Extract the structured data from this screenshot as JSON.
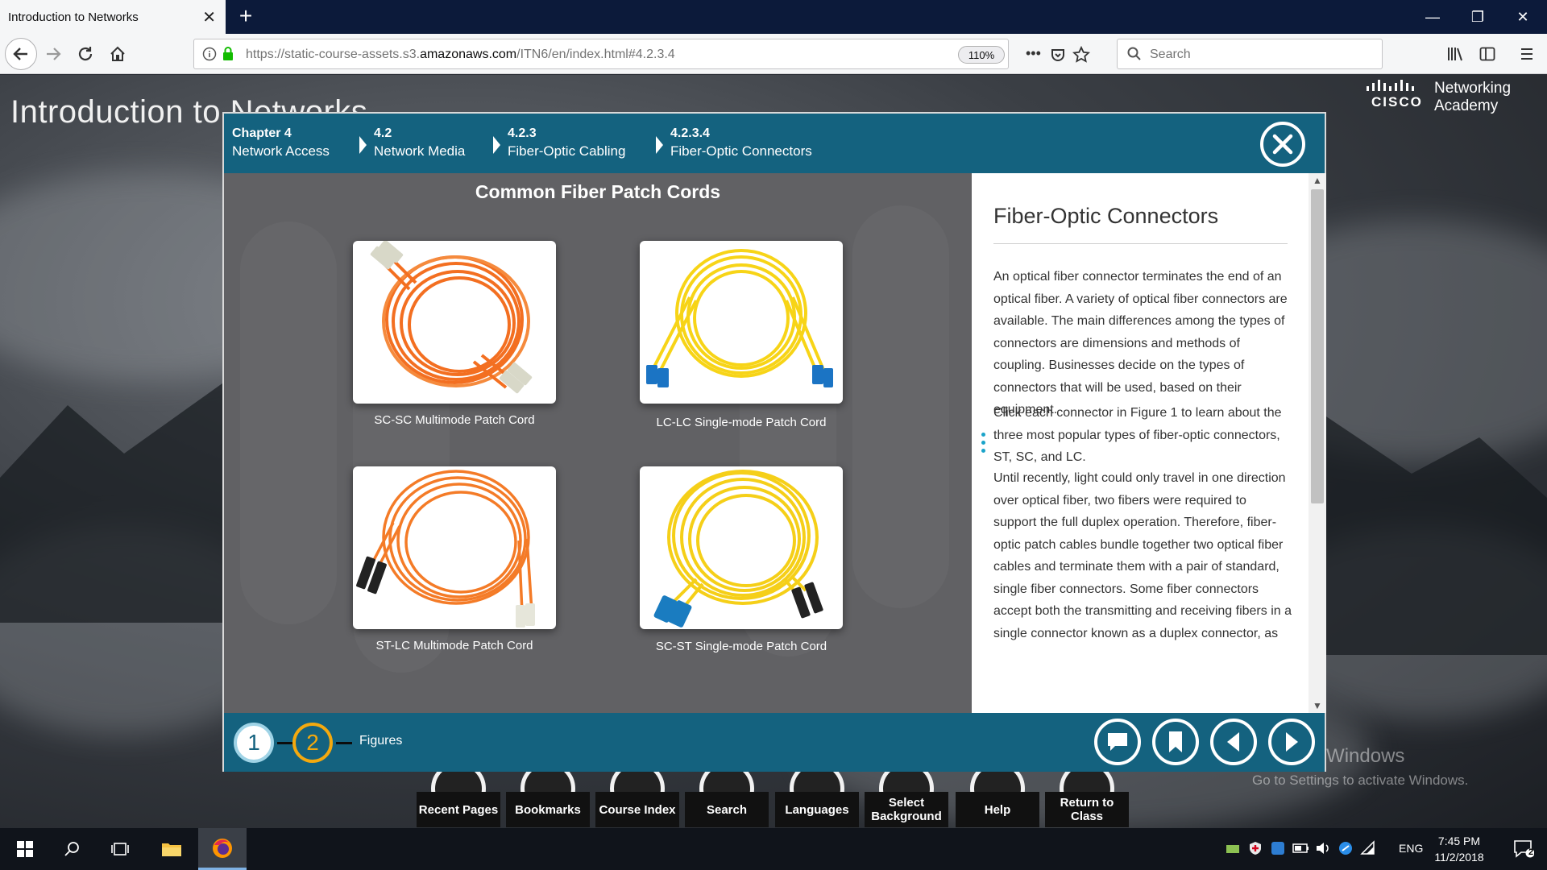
{
  "browser": {
    "tab_title": "Introduction to Networks",
    "url_host_prefix": "https://static-course-assets.s3.",
    "url_host_domain": "amazonaws.com",
    "url_path": "/ITN6/en/index.html#4.2.3.4",
    "zoom": "110%",
    "search_placeholder": "Search"
  },
  "page": {
    "course_title": "Introduction to Networks",
    "logo_brand": "CISCO",
    "logo_line1": "Networking",
    "logo_line2": "Academy"
  },
  "modal": {
    "breadcrumb": [
      {
        "num": "Chapter 4",
        "label": "Network Access"
      },
      {
        "num": "4.2",
        "label": "Network Media"
      },
      {
        "num": "4.2.3",
        "label": "Fiber-Optic Cabling"
      },
      {
        "num": "4.2.3.4",
        "label": "Fiber-Optic Connectors"
      }
    ],
    "figure_title": "Common Fiber Patch Cords",
    "cards": [
      {
        "caption": "SC-SC Multimode Patch Cord",
        "cable_color": "#f36f21"
      },
      {
        "caption": "LC-LC Single-mode Patch Cord",
        "cable_color": "#f7d417"
      },
      {
        "caption": "ST-LC Multimode Patch Cord",
        "cable_color": "#f47b27"
      },
      {
        "caption": "SC-ST Single-mode Patch Cord",
        "cable_color": "#f5cf18"
      }
    ],
    "panel_title": "Fiber-Optic Connectors",
    "paragraphs": [
      "An optical fiber connector terminates the end of an optical fiber. A variety of optical fiber connectors are available. The main differences among the types of connectors are dimensions and methods of coupling. Businesses decide on the types of connectors that will be used, based on their equipment.",
      "Click each connector in Figure 1 to learn about the three most popular types of fiber-optic connectors, ST, SC, and LC.",
      "Until recently, light could only travel in one direction over optical fiber, two fibers were required to support the full duplex operation. Therefore, fiber-optic patch cables bundle together two optical fiber cables and terminate them with a pair of standard, single fiber connectors. Some fiber connectors accept both the transmitting and receiving fibers in a single connector known as a duplex connector, as"
    ],
    "steps": [
      "1",
      "2"
    ],
    "figures_label": "Figures"
  },
  "toolbar": {
    "items": [
      {
        "label": "Recent Pages"
      },
      {
        "label": "Bookmarks"
      },
      {
        "label": "Course Index"
      },
      {
        "label": "Search"
      },
      {
        "label": "Languages"
      },
      {
        "label": "Select Background"
      },
      {
        "label": "Help"
      },
      {
        "label": "Return to Class"
      }
    ]
  },
  "watermark": {
    "line1": "Activate Windows",
    "line2": "Go to Settings to activate Windows."
  },
  "taskbar": {
    "language": "ENG",
    "time": "7:45 PM",
    "date": "11/2/2018",
    "notification_count": "2"
  },
  "colors": {
    "accent": "#14627f",
    "step_active": "#f4a90e",
    "taskbar": "#10141b"
  }
}
